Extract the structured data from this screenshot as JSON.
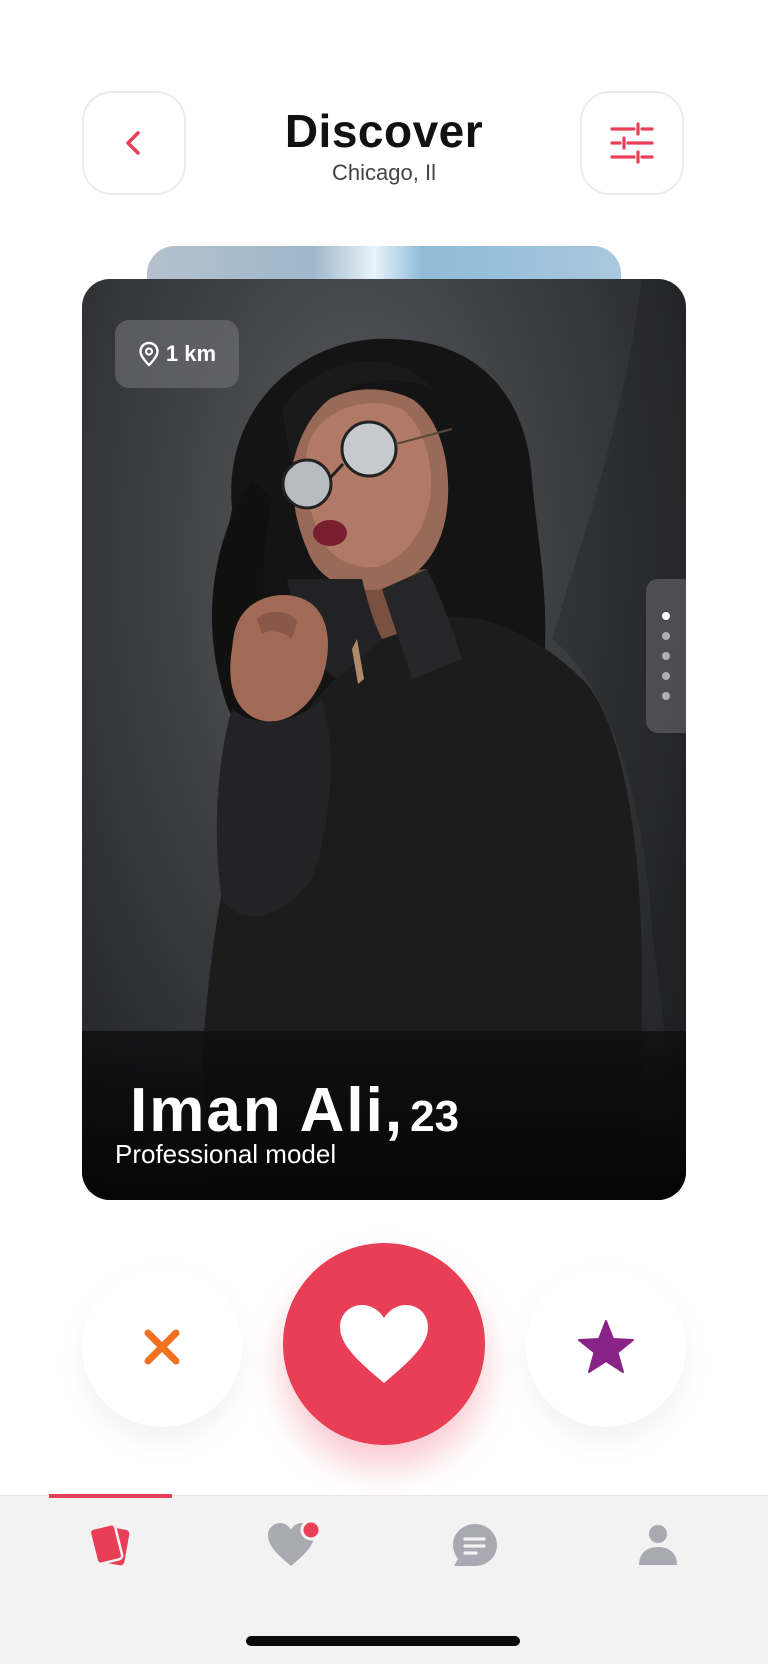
{
  "header": {
    "title": "Discover",
    "location": "Chicago, Il",
    "back_icon": "chevron-left-icon",
    "filter_icon": "sliders-icon",
    "accent_color": "#e83f57"
  },
  "profile_card": {
    "distance": "1 km",
    "name": "Iman Ali,",
    "age": "23",
    "occupation": "Professional model",
    "photo_count": 5,
    "active_photo": 1
  },
  "actions": {
    "dislike_icon": "close-icon",
    "like_icon": "heart-icon",
    "superlike_icon": "star-icon",
    "dislike_color": "#f27121",
    "like_color": "#e83f57",
    "superlike_color": "#8a2387"
  },
  "tabbar": {
    "tabs": [
      {
        "name": "cards",
        "icon": "cards-icon",
        "active": true
      },
      {
        "name": "matches",
        "icon": "heart-notification-icon",
        "active": false
      },
      {
        "name": "messages",
        "icon": "chat-icon",
        "active": false
      },
      {
        "name": "profile",
        "icon": "person-icon",
        "active": false
      }
    ]
  }
}
